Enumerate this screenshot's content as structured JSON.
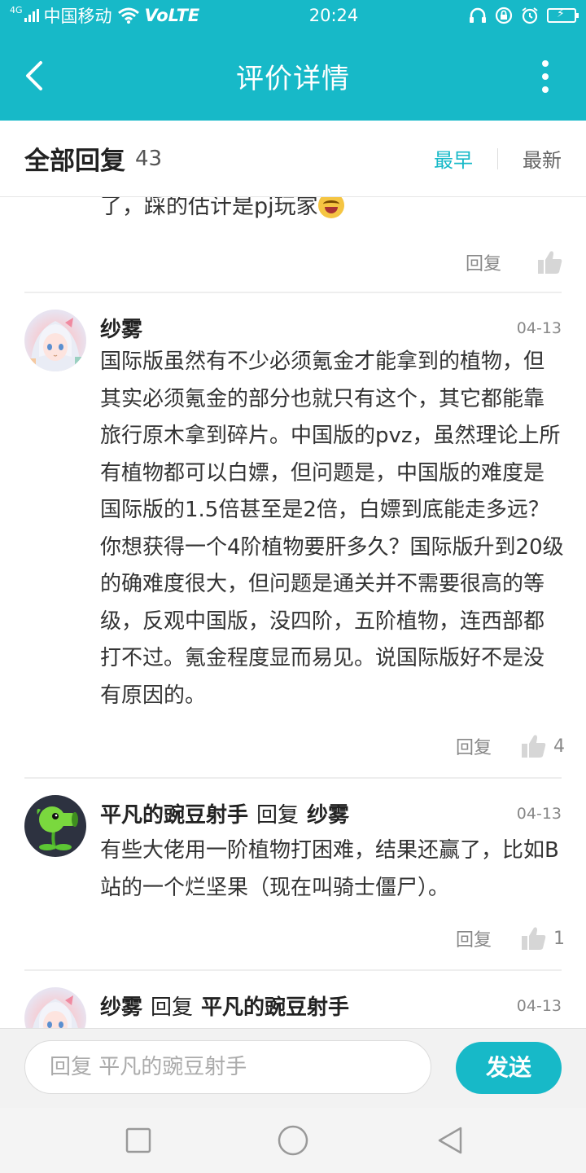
{
  "status_bar": {
    "network": "4G",
    "carrier": "中国移动",
    "volte": "VoLTE",
    "time": "20:24"
  },
  "header": {
    "title": "评价详情"
  },
  "replies_header": {
    "title": "全部回复",
    "count": "43",
    "sort_earliest": "最早",
    "sort_latest": "最新"
  },
  "fragment": {
    "text": "了，踩的估计是pj玩家",
    "reply_label": "回复"
  },
  "comments": [
    {
      "name": "纱雾",
      "date": "04-13",
      "body": "国际版虽然有不少必须氪金才能拿到的植物，但其实必须氪金的部分也就只有这个，其它都能靠旅行原木拿到碎片。中国版的pvz，虽然理论上所有植物都可以白嫖，但问题是，中国版的难度是国际版的1.5倍甚至是2倍，白嫖到底能走多远？你想获得一个4阶植物要肝多久？国际版升到20级的确难度很大，但问题是通关并不需要很高的等级，反观中国版，没四阶，五阶植物，连西部都打不过。氪金程度显而易见。说国际版好不是没有原因的。",
      "reply_label": "回复",
      "likes": "4"
    },
    {
      "name": "平凡的豌豆射手",
      "reply_word": "回复",
      "reply_to": "纱雾",
      "date": "04-13",
      "body": "有些大佬用一阶植物打困难，结果还赢了，比如B站的一个烂坚果（现在叫骑士僵尸）。",
      "reply_label": "回复",
      "likes": "1"
    },
    {
      "name": "纱雾",
      "reply_word": "回复",
      "reply_to": "平凡的豌豆射手",
      "date": "04-13"
    }
  ],
  "input": {
    "placeholder": "回复 平凡的豌豆射手",
    "send_label": "发送"
  },
  "colors": {
    "accent": "#17b9c8",
    "text": "#333333",
    "muted": "#888888"
  }
}
